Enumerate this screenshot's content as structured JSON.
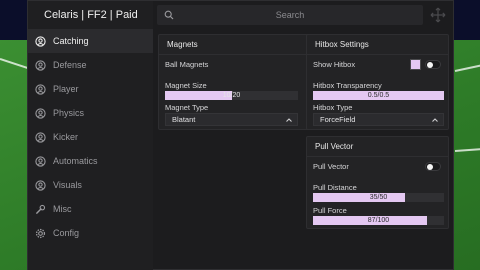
{
  "app": {
    "title": "Celaris | FF2 | Paid"
  },
  "search": {
    "placeholder": "Search"
  },
  "sidebar": {
    "items": [
      {
        "label": "Catching",
        "icon": "user-circle-icon",
        "active": true
      },
      {
        "label": "Defense",
        "icon": "user-circle-icon"
      },
      {
        "label": "Player",
        "icon": "user-circle-icon"
      },
      {
        "label": "Physics",
        "icon": "user-circle-icon"
      },
      {
        "label": "Kicker",
        "icon": "user-circle-icon"
      },
      {
        "label": "Automatics",
        "icon": "user-circle-icon"
      },
      {
        "label": "Visuals",
        "icon": "user-circle-icon"
      },
      {
        "label": "Misc",
        "icon": "wrench-icon"
      },
      {
        "label": "Config",
        "icon": "gear-icon"
      }
    ]
  },
  "magnets": {
    "title": "Magnets",
    "ball_magnets": {
      "label": "Ball Magnets",
      "on": false
    },
    "magnet_size": {
      "label": "Magnet Size",
      "value_text": "10/20",
      "fraction": 0.5
    },
    "magnet_type": {
      "label": "Magnet Type",
      "selected": "Blatant"
    }
  },
  "hitbox": {
    "title": "Hitbox Settings",
    "show_hitbox": {
      "label": "Show Hitbox",
      "on": false,
      "color": "#e4c8f2"
    },
    "transparency": {
      "label": "Hitbox Transparency",
      "value_text": "0.5/0.5",
      "fraction": 1.0
    },
    "hitbox_type": {
      "label": "Hitbox Type",
      "selected": "ForceField"
    }
  },
  "pull_vector": {
    "title": "Pull Vector",
    "toggle": {
      "label": "Pull Vector",
      "on": false
    },
    "distance": {
      "label": "Pull Distance",
      "value_text": "35/50",
      "fraction": 0.7
    },
    "force": {
      "label": "Pull Force",
      "value_text": "87/100",
      "fraction": 0.87
    }
  },
  "colors": {
    "accent": "#e4c8f2",
    "window_bg": "#1c1c1e",
    "panel_bg": "#232325"
  }
}
